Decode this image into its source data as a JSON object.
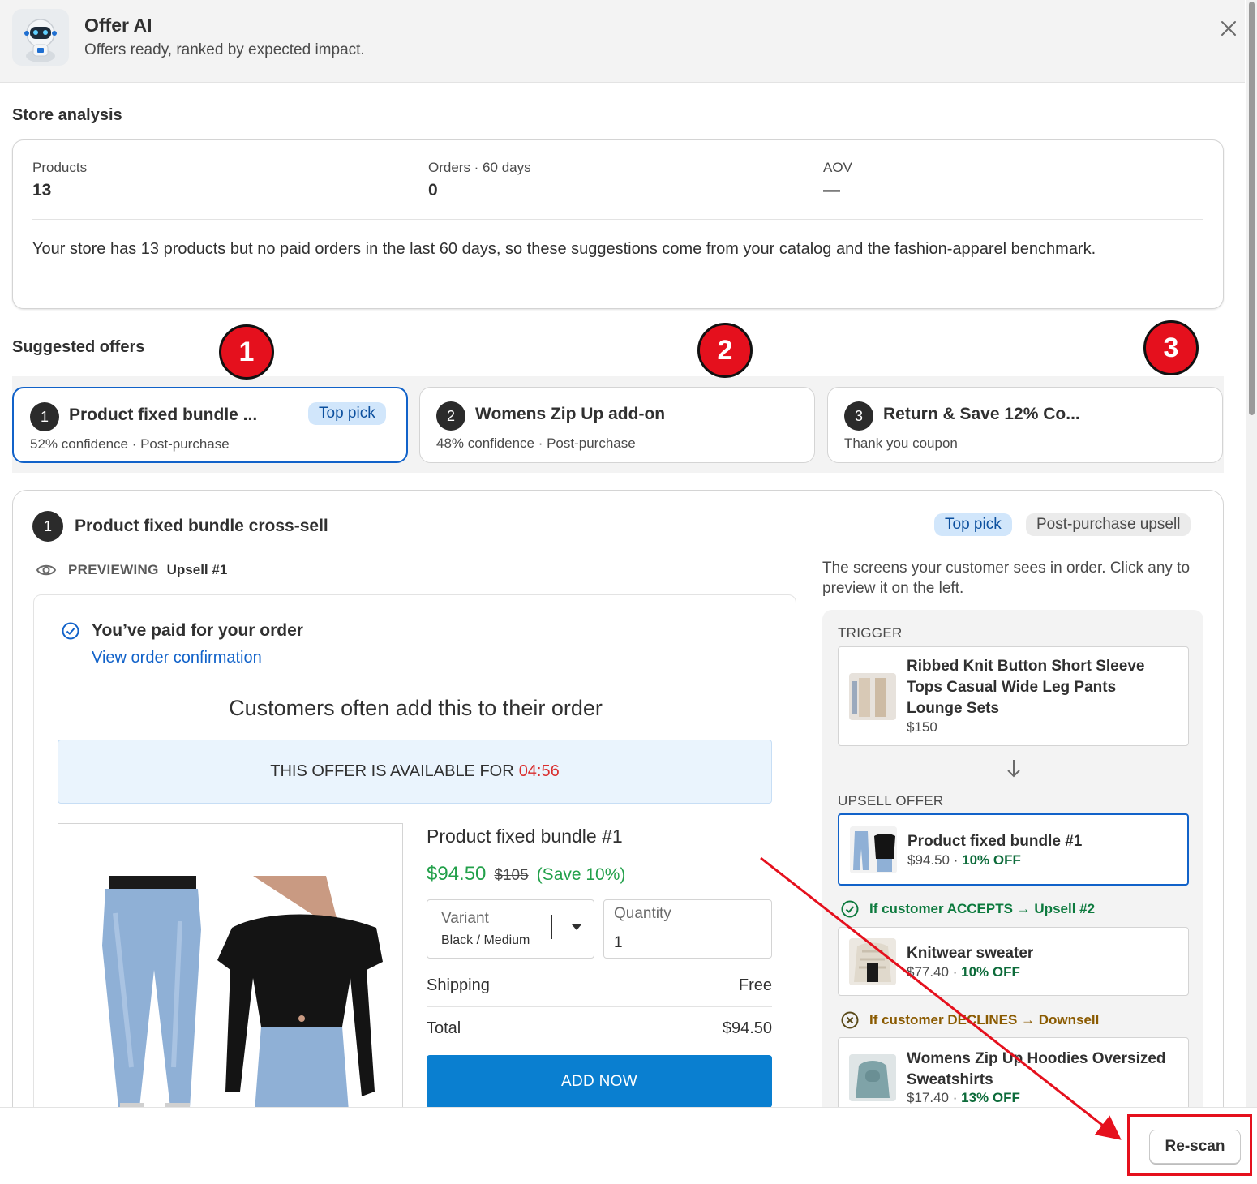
{
  "header": {
    "title": "Offer AI",
    "subtitle": "Offers ready, ranked by expected impact."
  },
  "store_analysis": {
    "heading": "Store analysis",
    "metrics": [
      {
        "label": "Products",
        "value": "13"
      },
      {
        "label": "Orders · 60 days",
        "value": "0"
      },
      {
        "label": "AOV",
        "value": "—"
      }
    ],
    "summary": "Your store has 13 products but no paid orders in the last 60 days, so these suggestions come from your catalog and the fashion-apparel benchmark."
  },
  "suggested": {
    "heading": "Suggested offers",
    "markers": [
      "1",
      "2",
      "3"
    ],
    "tabs": [
      {
        "num": "1",
        "title": "Product fixed bundle ...",
        "meta": "52% confidence · Post-purchase",
        "badge": "Top pick",
        "active": true
      },
      {
        "num": "2",
        "title": "Womens Zip Up add-on",
        "meta": "48% confidence · Post-purchase",
        "badge": "",
        "active": false
      },
      {
        "num": "3",
        "title": "Return & Save 12% Co...",
        "meta": "Thank you coupon",
        "badge": "",
        "active": false
      }
    ]
  },
  "detail": {
    "num": "1",
    "title": "Product fixed bundle cross-sell",
    "badges": [
      "Top pick",
      "Post-purchase upsell"
    ],
    "previewing_label": "PREVIEWING",
    "previewing_name": "Upsell #1",
    "preview": {
      "paid_title": "You’ve paid for your order",
      "confirm_link": "View order confirmation",
      "heading": "Customers often add this to their order",
      "timer_text": "THIS OFFER IS AVAILABLE FOR",
      "timer_value": "04:56",
      "product_title": "Product fixed bundle #1",
      "price": "$94.50",
      "compare_price": "$105",
      "save": "(Save 10%)",
      "variant_label": "Variant",
      "variant_value": "Black / Medium",
      "quantity_label": "Quantity",
      "quantity_value": "1",
      "shipping_label": "Shipping",
      "shipping_value": "Free",
      "total_label": "Total",
      "total_value": "$94.50",
      "add_button": "ADD NOW"
    },
    "flow": {
      "description": "The screens your customer sees in order. Click any to preview it on the left.",
      "trigger_label": "TRIGGER",
      "trigger": {
        "name": "Ribbed Knit Button Short Sleeve Tops Casual Wide Leg Pants Lounge Sets",
        "price": "$150"
      },
      "upsell_label": "UPSELL OFFER",
      "upsell": {
        "name": "Product fixed bundle #1",
        "price": "$94.50",
        "off": "10% OFF"
      },
      "accept_label": "If customer ACCEPTS → Upsell #2",
      "accept_offer": {
        "name": "Knitwear sweater",
        "price": "$77.40",
        "off": "10% OFF"
      },
      "decline_label": "If customer DECLINES → Downsell",
      "decline_offer": {
        "name": "Womens Zip Up Hoodies Oversized Sweatshirts",
        "price": "$17.40",
        "off": "13% OFF"
      }
    }
  },
  "footer": {
    "rescan_label": "Re-scan"
  },
  "colors": {
    "accent_blue": "#1162c9",
    "add_button_blue": "#0a7fd0",
    "price_green": "#22a04a",
    "timer_red": "#d92e2e",
    "annotation_red": "#e5101d"
  }
}
